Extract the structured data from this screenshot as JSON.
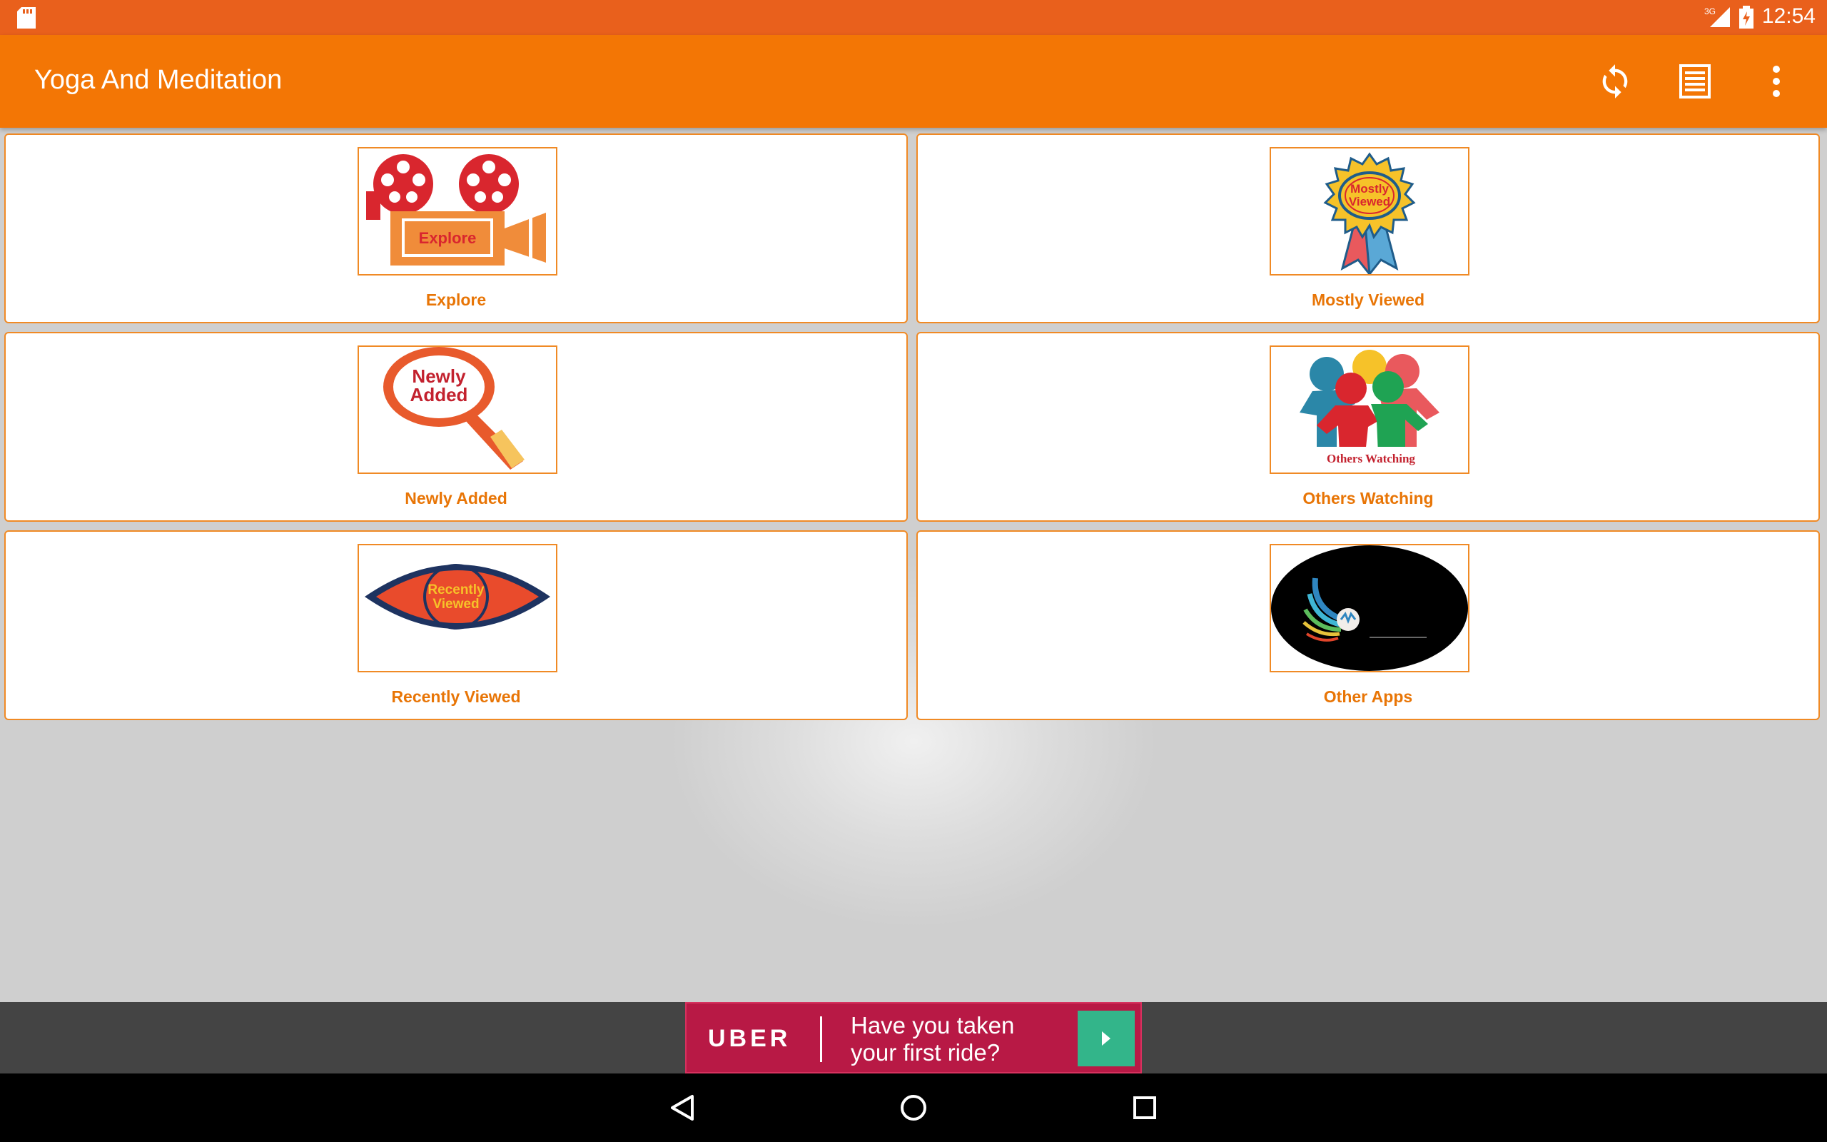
{
  "status_bar": {
    "time": "12:54",
    "network": "3G",
    "icons": [
      "sd-card-icon",
      "signal-icon",
      "battery-charging-icon"
    ]
  },
  "app_bar": {
    "title": "Yoga And Meditation",
    "actions": [
      "refresh-icon",
      "list-icon",
      "overflow-menu-icon"
    ]
  },
  "tiles": [
    {
      "label": "Explore",
      "image_text": "Explore"
    },
    {
      "label": "Mostly Viewed",
      "image_text_line1": "Mostly",
      "image_text_line2": "Viewed"
    },
    {
      "label": "Newly Added",
      "image_text_line1": "Newly",
      "image_text_line2": "Added"
    },
    {
      "label": "Others Watching",
      "image_text": "Others Watching"
    },
    {
      "label": "Recently Viewed",
      "image_text_line1": "Recently",
      "image_text_line2": "Viewed"
    },
    {
      "label": "Other Apps"
    }
  ],
  "ad": {
    "brand": "UBER",
    "text_line1": "Have you taken",
    "text_line2": "your first ride?"
  },
  "nav": [
    "back-icon",
    "home-icon",
    "recents-icon"
  ],
  "colors": {
    "status_bar": "#e9601c",
    "app_bar": "#f37605",
    "accent": "#e87506",
    "ad_background": "#b81945",
    "ad_cta": "#33b58a"
  }
}
